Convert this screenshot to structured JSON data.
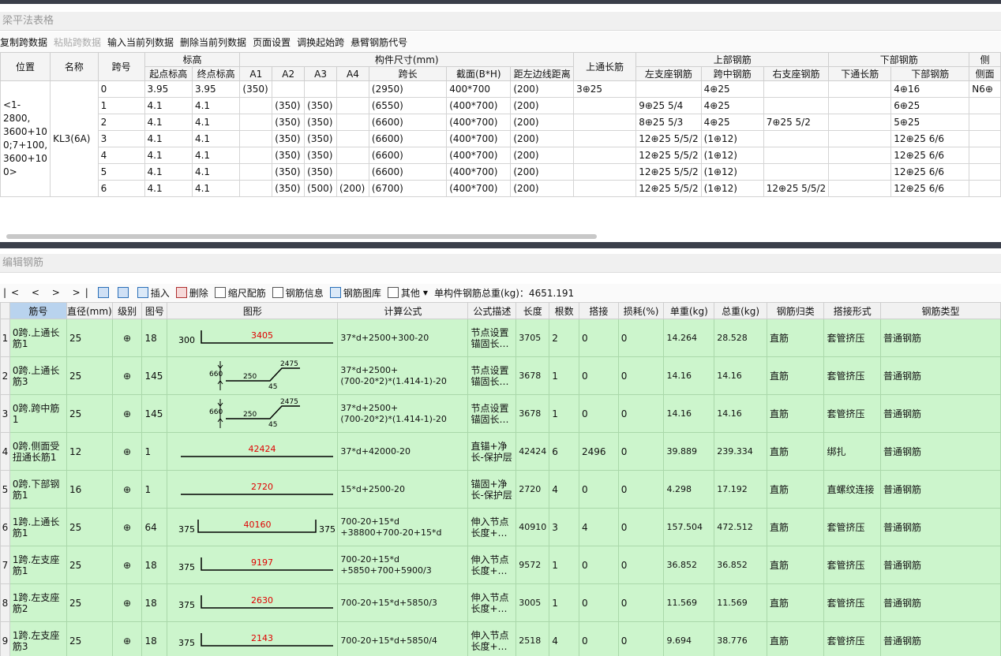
{
  "top_panel": {
    "title": "梁平法表格"
  },
  "top_toolbar": [
    "复制跨数据",
    "粘贴跨数据",
    "输入当前列数据",
    "删除当前列数据",
    "页面设置",
    "调换起始跨",
    "悬臂钢筋代号"
  ],
  "top_toolbar_disabled": [
    1
  ],
  "upper_headers": {
    "groups": [
      "位置",
      "名称",
      "跨号",
      "标高",
      "构件尺寸(mm)",
      "上通长筋",
      "上部钢筋",
      "下部钢筋",
      "侧"
    ],
    "sub": [
      "起点标高",
      "终点标高",
      "A1",
      "A2",
      "A3",
      "A4",
      "跨长",
      "截面(B*H)",
      "距左边线距离",
      "左支座钢筋",
      "跨中钢筋",
      "右支座钢筋",
      "下通长筋",
      "下部钢筋",
      "侧面"
    ]
  },
  "beam": {
    "position": "<1-2800,\n3600+10\n0;7+100,\n3600+10\n0>",
    "name": "KL3(6A)"
  },
  "spans": [
    [
      "0",
      "3.95",
      "3.95",
      "(350)",
      "",
      "",
      "",
      "(2950)",
      "400*700",
      "(200)",
      "3⊕25",
      "",
      "4⊕25",
      "",
      "",
      "4⊕16",
      "N6⊕"
    ],
    [
      "1",
      "4.1",
      "4.1",
      "",
      "(350)",
      "(350)",
      "",
      "(6550)",
      "(400*700)",
      "(200)",
      "",
      "9⊕25 5/4",
      "4⊕25",
      "",
      "",
      "6⊕25",
      ""
    ],
    [
      "2",
      "4.1",
      "4.1",
      "",
      "(350)",
      "(350)",
      "",
      "(6600)",
      "(400*700)",
      "(200)",
      "",
      "8⊕25 5/3",
      "4⊕25",
      "7⊕25 5/2",
      "",
      "5⊕25",
      ""
    ],
    [
      "3",
      "4.1",
      "4.1",
      "",
      "(350)",
      "(350)",
      "",
      "(6600)",
      "(400*700)",
      "(200)",
      "",
      "12⊕25 5/5/2",
      "(1⊕12)",
      "",
      "",
      "12⊕25 6/6",
      ""
    ],
    [
      "4",
      "4.1",
      "4.1",
      "",
      "(350)",
      "(350)",
      "",
      "(6600)",
      "(400*700)",
      "(200)",
      "",
      "12⊕25 5/5/2",
      "(1⊕12)",
      "",
      "",
      "12⊕25 6/6",
      ""
    ],
    [
      "5",
      "4.1",
      "4.1",
      "",
      "(350)",
      "(350)",
      "",
      "(6600)",
      "(400*700)",
      "(200)",
      "",
      "12⊕25 5/5/2",
      "(1⊕12)",
      "",
      "",
      "12⊕25 6/6",
      ""
    ],
    [
      "6",
      "4.1",
      "4.1",
      "",
      "(350)",
      "(500)",
      "(200)",
      "(6700)",
      "(400*700)",
      "(200)",
      "",
      "12⊕25 5/5/2",
      "(1⊕12)",
      "12⊕25 5/5/2",
      "",
      "12⊕25 6/6",
      ""
    ]
  ],
  "bottom_panel": {
    "title": "编辑钢筋"
  },
  "bottom_toolbar": {
    "nav": "|<  <  >  >|",
    "insert": "插入",
    "delete": "删除",
    "scale": "缩尺配筋",
    "info": "钢筋信息",
    "library": "钢筋图库",
    "other": "其他",
    "total": "单构件钢筋总重(kg)：4651.191"
  },
  "rebar_headers": [
    "",
    "筋号",
    "直径(mm)",
    "级别",
    "图号",
    "图形",
    "计算公式",
    "公式描述",
    "长度",
    "根数",
    "搭接",
    "损耗(%)",
    "单重(kg)",
    "总重(kg)",
    "钢筋归类",
    "搭接形式",
    "钢筋类型"
  ],
  "rebar_rows": [
    {
      "n": "1",
      "name": "0跨.上通长筋1",
      "dia": "25",
      "grade": "⊕",
      "fig": "18",
      "formula": "37*d+2500+300-20",
      "desc": "节点设置锚固长…",
      "len": "3705",
      "cnt": "2",
      "lap": "0",
      "loss": "0",
      "unit": "14.264",
      "total": "28.528",
      "cat": "直筋",
      "lapf": "套管挤压",
      "type": "普通钢筋",
      "shape": {
        "kind": "hook18",
        "left": "300",
        "main": "3405"
      }
    },
    {
      "n": "2",
      "name": "0跨.上通长筋3",
      "dia": "25",
      "grade": "⊕",
      "fig": "145",
      "formula": "37*d+2500+\n(700-20*2)*(1.414-1)-20",
      "desc": "节点设置锚固长…",
      "len": "3678",
      "cnt": "1",
      "lap": "0",
      "loss": "0",
      "unit": "14.16",
      "total": "14.16",
      "cat": "直筋",
      "lapf": "套管挤压",
      "type": "普通钢筋",
      "shape": {
        "kind": "bent145",
        "h": "660",
        "a": "250",
        "b": "45",
        "c": "2475"
      }
    },
    {
      "n": "3",
      "name": "0跨.跨中筋1",
      "dia": "25",
      "grade": "⊕",
      "fig": "145",
      "formula": "37*d+2500+\n(700-20*2)*(1.414-1)-20",
      "desc": "节点设置锚固长…",
      "len": "3678",
      "cnt": "1",
      "lap": "0",
      "loss": "0",
      "unit": "14.16",
      "total": "14.16",
      "cat": "直筋",
      "lapf": "套管挤压",
      "type": "普通钢筋",
      "shape": {
        "kind": "bent145",
        "h": "660",
        "a": "250",
        "b": "45",
        "c": "2475"
      }
    },
    {
      "n": "4",
      "name": "0跨.侧面受扭通长筋1",
      "dia": "12",
      "grade": "⊕",
      "fig": "1",
      "formula": "37*d+42000-20",
      "desc": "直锚+净长-保护层",
      "len": "42424",
      "cnt": "6",
      "lap": "2496",
      "loss": "0",
      "unit": "39.889",
      "total": "239.334",
      "cat": "直筋",
      "lapf": "绑扎",
      "type": "普通钢筋",
      "shape": {
        "kind": "straight",
        "main": "42424"
      }
    },
    {
      "n": "5",
      "name": "0跨.下部钢筋1",
      "dia": "16",
      "grade": "⊕",
      "fig": "1",
      "formula": "15*d+2500-20",
      "desc": "锚固+净长-保护层",
      "len": "2720",
      "cnt": "4",
      "lap": "0",
      "loss": "0",
      "unit": "4.298",
      "total": "17.192",
      "cat": "直筋",
      "lapf": "直螺纹连接",
      "type": "普通钢筋",
      "shape": {
        "kind": "straight",
        "main": "2720"
      }
    },
    {
      "n": "6",
      "name": "1跨.上通长筋1",
      "dia": "25",
      "grade": "⊕",
      "fig": "64",
      "formula": "700-20+15*d\n+38800+700-20+15*d",
      "desc": "伸入节点长度+…",
      "len": "40910",
      "cnt": "3",
      "lap": "4",
      "loss": "0",
      "unit": "157.504",
      "total": "472.512",
      "cat": "直筋",
      "lapf": "套管挤压",
      "type": "普通钢筋",
      "shape": {
        "kind": "u64",
        "left": "375",
        "main": "40160",
        "right": "375"
      }
    },
    {
      "n": "7",
      "name": "1跨.左支座筋1",
      "dia": "25",
      "grade": "⊕",
      "fig": "18",
      "formula": "700-20+15*d\n+5850+700+5900/3",
      "desc": "伸入节点长度+…",
      "len": "9572",
      "cnt": "1",
      "lap": "0",
      "loss": "0",
      "unit": "36.852",
      "total": "36.852",
      "cat": "直筋",
      "lapf": "套管挤压",
      "type": "普通钢筋",
      "shape": {
        "kind": "hook18",
        "left": "375",
        "main": "9197"
      }
    },
    {
      "n": "8",
      "name": "1跨.左支座筋2",
      "dia": "25",
      "grade": "⊕",
      "fig": "18",
      "formula": "700-20+15*d+5850/3",
      "desc": "伸入节点长度+…",
      "len": "3005",
      "cnt": "1",
      "lap": "0",
      "loss": "0",
      "unit": "11.569",
      "total": "11.569",
      "cat": "直筋",
      "lapf": "套管挤压",
      "type": "普通钢筋",
      "shape": {
        "kind": "hook18",
        "left": "375",
        "main": "2630"
      }
    },
    {
      "n": "9",
      "name": "1跨.左支座筋3",
      "dia": "25",
      "grade": "⊕",
      "fig": "18",
      "formula": "700-20+15*d+5850/4",
      "desc": "伸入节点长度+…",
      "len": "2518",
      "cnt": "4",
      "lap": "0",
      "loss": "0",
      "unit": "9.694",
      "total": "38.776",
      "cat": "直筋",
      "lapf": "套管挤压",
      "type": "普通钢筋",
      "shape": {
        "kind": "hook18",
        "left": "375",
        "main": "2143"
      }
    }
  ],
  "colors": {
    "row_bg": "#ccf5cc",
    "dim_text": "#e00000",
    "chrome": "#3b3f4a"
  }
}
